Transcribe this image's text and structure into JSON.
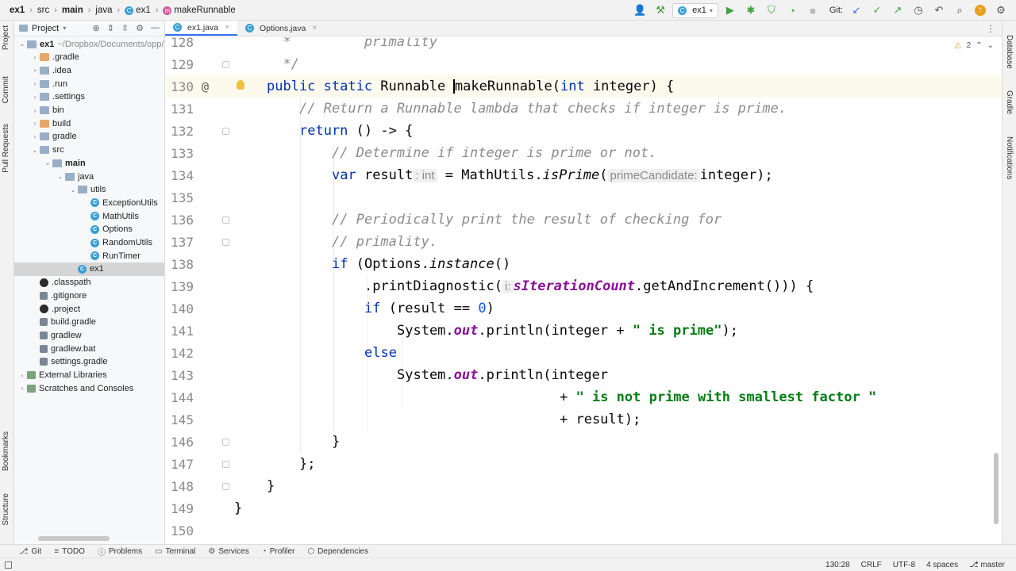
{
  "navbar": {
    "breadcrumbs": [
      {
        "label": "ex1",
        "bold": true
      },
      {
        "label": "src"
      },
      {
        "label": "main",
        "bold": true
      },
      {
        "label": "java"
      },
      {
        "label": "ex1",
        "icon": "class-icon"
      },
      {
        "label": "makeRunnable",
        "icon": "method-icon"
      }
    ],
    "run_config": "ex1",
    "git_label": "Git:"
  },
  "left_strip": {
    "project": "Project",
    "commit": "Commit",
    "pull_requests": "Pull Requests",
    "bookmarks": "Bookmarks",
    "structure": "Structure"
  },
  "right_strip": {
    "database": "Database",
    "gradle": "Gradle",
    "notifications": "Notifications"
  },
  "project_panel": {
    "title": "Project",
    "tree": [
      {
        "label": "ex1",
        "extra": "~/Dropbox/Documents/opp/",
        "bold": true,
        "depth": 0,
        "arrow": "▾",
        "icon": "folder"
      },
      {
        "label": ".gradle",
        "depth": 1,
        "arrow": "▸",
        "icon": "orange"
      },
      {
        "label": ".idea",
        "depth": 1,
        "arrow": "▸",
        "icon": "folder"
      },
      {
        "label": ".run",
        "depth": 1,
        "arrow": "▸",
        "icon": "folder"
      },
      {
        "label": ".settings",
        "depth": 1,
        "arrow": "▸",
        "icon": "folder"
      },
      {
        "label": "bin",
        "depth": 1,
        "arrow": "▸",
        "icon": "folder"
      },
      {
        "label": "build",
        "depth": 1,
        "arrow": "▸",
        "icon": "orange"
      },
      {
        "label": "gradle",
        "depth": 1,
        "arrow": "▸",
        "icon": "folder"
      },
      {
        "label": "src",
        "depth": 1,
        "arrow": "▾",
        "icon": "folder"
      },
      {
        "label": "main",
        "bold": true,
        "depth": 2,
        "arrow": "▾",
        "icon": "folder"
      },
      {
        "label": "java",
        "depth": 3,
        "arrow": "▾",
        "icon": "folder"
      },
      {
        "label": "utils",
        "depth": 4,
        "arrow": "▾",
        "icon": "folder"
      },
      {
        "label": "ExceptionUtils",
        "depth": 5,
        "arrow": "",
        "icon": "cls"
      },
      {
        "label": "MathUtils",
        "depth": 5,
        "arrow": "",
        "icon": "cls"
      },
      {
        "label": "Options",
        "depth": 5,
        "arrow": "",
        "icon": "cls"
      },
      {
        "label": "RandomUtils",
        "depth": 5,
        "arrow": "",
        "icon": "cls"
      },
      {
        "label": "RunTimer",
        "depth": 5,
        "arrow": "",
        "icon": "cls"
      },
      {
        "label": "ex1",
        "depth": 4,
        "arrow": "",
        "icon": "cls",
        "selected": true
      },
      {
        "label": ".classpath",
        "depth": 1,
        "arrow": "",
        "icon": "dark"
      },
      {
        "label": ".gitignore",
        "depth": 1,
        "arrow": "",
        "icon": "file"
      },
      {
        "label": ".project",
        "depth": 1,
        "arrow": "",
        "icon": "dark"
      },
      {
        "label": "build.gradle",
        "depth": 1,
        "arrow": "",
        "icon": "file"
      },
      {
        "label": "gradlew",
        "depth": 1,
        "arrow": "",
        "icon": "file"
      },
      {
        "label": "gradlew.bat",
        "depth": 1,
        "arrow": "",
        "icon": "file"
      },
      {
        "label": "settings.gradle",
        "depth": 1,
        "arrow": "",
        "icon": "file"
      },
      {
        "label": "External Libraries",
        "depth": 0,
        "arrow": "▸",
        "icon": "lib"
      },
      {
        "label": "Scratches and Consoles",
        "depth": 0,
        "arrow": "▸",
        "icon": "lib"
      }
    ]
  },
  "tabs": [
    {
      "label": "ex1.java",
      "active": true
    },
    {
      "label": "Options.java",
      "active": false
    }
  ],
  "editor": {
    "warning_count": "2",
    "current_line": 130,
    "lines": [
      {
        "n": "128",
        "indent": 0,
        "tokens": [
          {
            "t": "  *         primality",
            "c": "cm"
          }
        ]
      },
      {
        "n": "129",
        "indent": 0,
        "tokens": [
          {
            "t": "  */",
            "c": "cm"
          }
        ]
      },
      {
        "n": "130",
        "indent": 0,
        "at": true,
        "bulb": true,
        "tokens": [
          {
            "t": "public static ",
            "c": "kw"
          },
          {
            "t": "Runnable ",
            "c": ""
          },
          {
            "caret": true
          },
          {
            "t": "makeRunnable(",
            "c": ""
          },
          {
            "t": "int ",
            "c": "kw"
          },
          {
            "t": "integer) {",
            "c": ""
          }
        ]
      },
      {
        "n": "131",
        "indent": 1,
        "tokens": [
          {
            "t": "// Return a Runnable lambda that checks if integer is prime.",
            "c": "cm"
          }
        ]
      },
      {
        "n": "132",
        "indent": 1,
        "tokens": [
          {
            "t": "return ",
            "c": "kw"
          },
          {
            "t": "() -> {",
            "c": ""
          }
        ]
      },
      {
        "n": "133",
        "indent": 2,
        "tokens": [
          {
            "t": "// Determine if integer is prime or not.",
            "c": "cm"
          }
        ]
      },
      {
        "n": "134",
        "indent": 2,
        "tokens": [
          {
            "t": "var ",
            "c": "kw"
          },
          {
            "t": "result",
            "c": ""
          },
          {
            "hint": ": int"
          },
          {
            "t": " = MathUtils.",
            "c": ""
          },
          {
            "t": "isPrime",
            "c": "it"
          },
          {
            "t": "(",
            "c": ""
          },
          {
            "hint": "primeCandidate:"
          },
          {
            "t": "integer);",
            "c": ""
          }
        ]
      },
      {
        "n": "135",
        "indent": 2,
        "tokens": []
      },
      {
        "n": "136",
        "indent": 2,
        "tokens": [
          {
            "t": "// Periodically print the result of checking for",
            "c": "cm"
          }
        ]
      },
      {
        "n": "137",
        "indent": 2,
        "tokens": [
          {
            "t": "// primality.",
            "c": "cm"
          }
        ]
      },
      {
        "n": "138",
        "indent": 2,
        "tokens": [
          {
            "t": "if ",
            "c": "kw"
          },
          {
            "t": "(Options.",
            "c": ""
          },
          {
            "t": "instance",
            "c": "it"
          },
          {
            "t": "()",
            "c": ""
          }
        ]
      },
      {
        "n": "139",
        "indent": 3,
        "tokens": [
          {
            "t": ".printDiagnostic(",
            "c": ""
          },
          {
            "hint": "i:"
          },
          {
            "t": "sIterationCount",
            "c": "fld"
          },
          {
            "t": ".getAndIncrement())) {",
            "c": ""
          }
        ]
      },
      {
        "n": "140",
        "indent": 3,
        "tokens": [
          {
            "t": "if ",
            "c": "kw"
          },
          {
            "t": "(result == ",
            "c": ""
          },
          {
            "t": "0",
            "c": "num"
          },
          {
            "t": ")",
            "c": ""
          }
        ]
      },
      {
        "n": "141",
        "indent": 4,
        "tokens": [
          {
            "t": "System.",
            "c": ""
          },
          {
            "t": "out",
            "c": "fld"
          },
          {
            "t": ".println(integer + ",
            "c": ""
          },
          {
            "t": "\" is prime\"",
            "c": "str"
          },
          {
            "t": ");",
            "c": ""
          }
        ]
      },
      {
        "n": "142",
        "indent": 3,
        "tokens": [
          {
            "t": "else",
            "c": "kw"
          }
        ]
      },
      {
        "n": "143",
        "indent": 4,
        "tokens": [
          {
            "t": "System.",
            "c": ""
          },
          {
            "t": "out",
            "c": "fld"
          },
          {
            "t": ".println(integer",
            "c": ""
          }
        ]
      },
      {
        "n": "144",
        "indent": 9,
        "tokens": [
          {
            "t": "+ ",
            "c": ""
          },
          {
            "t": "\" is not prime with smallest factor \"",
            "c": "str"
          }
        ]
      },
      {
        "n": "145",
        "indent": 9,
        "tokens": [
          {
            "t": "+ result);",
            "c": ""
          }
        ]
      },
      {
        "n": "146",
        "indent": 2,
        "tokens": [
          {
            "t": "}",
            "c": ""
          }
        ]
      },
      {
        "n": "147",
        "indent": 1,
        "tokens": [
          {
            "t": "};",
            "c": ""
          }
        ]
      },
      {
        "n": "148",
        "indent": 0,
        "tokens": [
          {
            "t": "}",
            "c": ""
          }
        ]
      },
      {
        "n": "149",
        "indent": -1,
        "tokens": [
          {
            "t": "}",
            "c": ""
          }
        ]
      },
      {
        "n": "150",
        "indent": 0,
        "tokens": []
      }
    ]
  },
  "bottom_tools": [
    {
      "label": "Git",
      "icon": "git-icon"
    },
    {
      "label": "TODO",
      "icon": "list-icon"
    },
    {
      "label": "Problems",
      "icon": "info-icon"
    },
    {
      "label": "Terminal",
      "icon": "terminal-icon"
    },
    {
      "label": "Services",
      "icon": "services-icon"
    },
    {
      "label": "Profiler",
      "icon": "profiler-icon"
    },
    {
      "label": "Dependencies",
      "icon": "dependencies-icon"
    }
  ],
  "status": {
    "position": "130:28",
    "line_sep": "CRLF",
    "encoding": "UTF-8",
    "indent": "4 spaces",
    "branch": "master"
  }
}
